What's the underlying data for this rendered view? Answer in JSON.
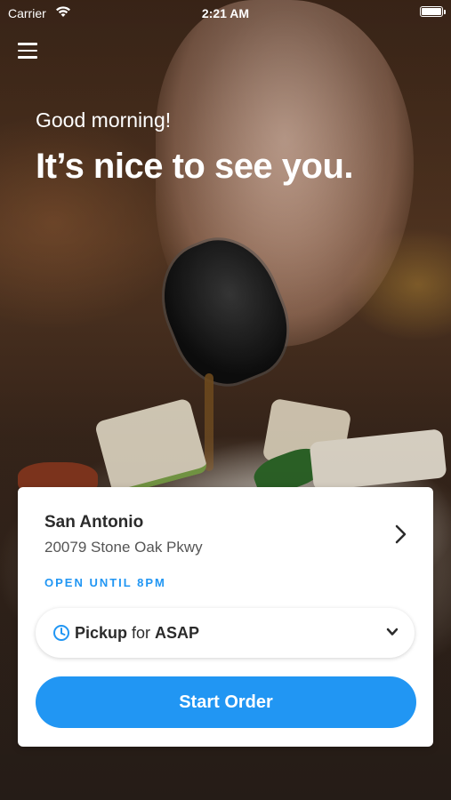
{
  "status_bar": {
    "carrier": "Carrier",
    "time": "2:21 AM"
  },
  "icons": {
    "menu": "hamburger-menu-icon",
    "wifi": "wifi-icon",
    "battery": "battery-icon",
    "chevron": "chevron-right-icon",
    "clock": "clock-icon",
    "dropdown": "chevron-down-icon"
  },
  "hero": {
    "greeting": "Good morning!",
    "headline": "It’s nice to see you."
  },
  "location": {
    "name": "San Antonio",
    "address": "20079 Stone Oak Pkwy",
    "status": "OPEN UNTIL 8PM"
  },
  "order_mode": {
    "mode": "Pickup",
    "connector": " for ",
    "when": "ASAP"
  },
  "actions": {
    "start_order": "Start Order"
  },
  "colors": {
    "accent": "#2196f3",
    "card_background": "#ffffff",
    "text_primary": "#2b2b2b"
  }
}
